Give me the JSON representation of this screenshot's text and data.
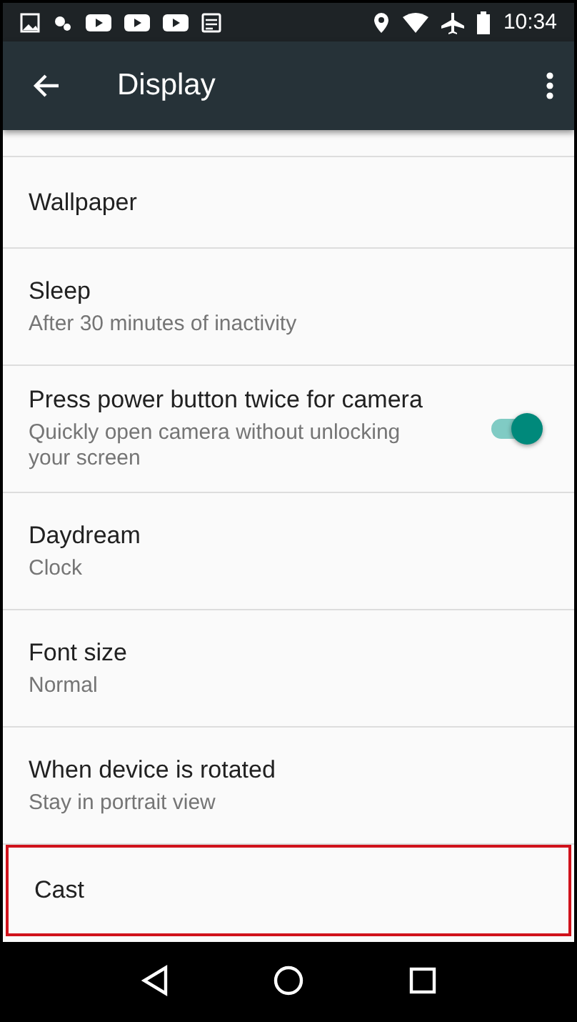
{
  "status_bar": {
    "time": "10:34"
  },
  "toolbar": {
    "title": "Display"
  },
  "settings": [
    {
      "kind": "plain",
      "title": "Wallpaper",
      "highlighted": false
    },
    {
      "kind": "plain",
      "title": "Sleep",
      "summary": "After 30 minutes of inactivity",
      "highlighted": false
    },
    {
      "kind": "switch",
      "title": "Press power button twice for camera",
      "summary": "Quickly open camera without unlocking your screen",
      "on": true,
      "highlighted": false
    },
    {
      "kind": "plain",
      "title": "Daydream",
      "summary": "Clock",
      "highlighted": false
    },
    {
      "kind": "plain",
      "title": "Font size",
      "summary": "Normal",
      "highlighted": false
    },
    {
      "kind": "plain",
      "title": "When device is rotated",
      "summary": "Stay in portrait view",
      "highlighted": false
    },
    {
      "kind": "plain",
      "title": "Cast",
      "highlighted": true
    }
  ]
}
